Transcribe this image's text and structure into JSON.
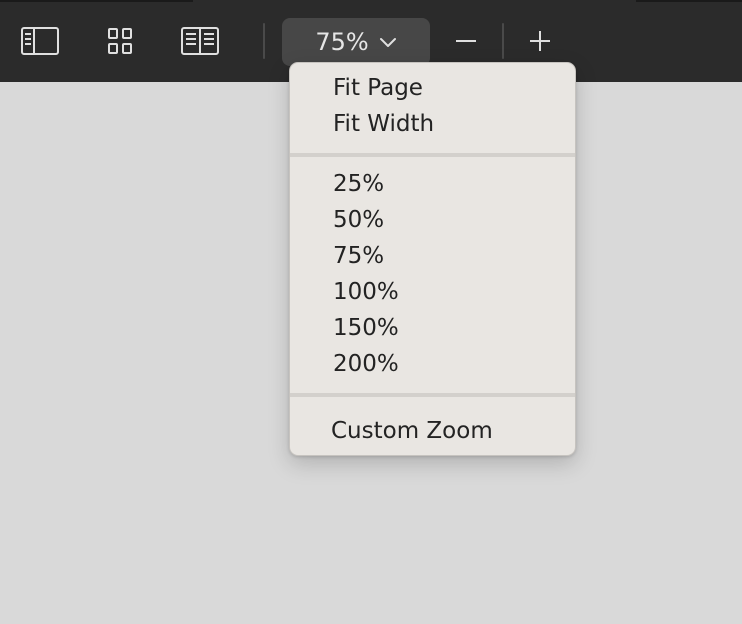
{
  "toolbar": {
    "buttons": [
      {
        "icon": "sidebar-icon"
      },
      {
        "icon": "contact-sheet-icon"
      },
      {
        "icon": "two-pages-icon"
      }
    ],
    "zoom": {
      "value": "75%",
      "chevron_icon": "chevron-down-icon"
    },
    "zoom_out_icon": "minus-icon",
    "zoom_in_icon": "plus-icon"
  },
  "zoom_menu": {
    "fit_items": [
      "Fit Page",
      "Fit Width"
    ],
    "percent_items": [
      "25%",
      "50%",
      "75%",
      "100%",
      "150%",
      "200%"
    ],
    "custom_label": "Custom Zoom"
  },
  "colors": {
    "toolbar_bg": "#2b2b2b",
    "content_bg": "#d9d9d9",
    "menu_bg": "#e9e6e2",
    "menu_text": "#232323"
  }
}
